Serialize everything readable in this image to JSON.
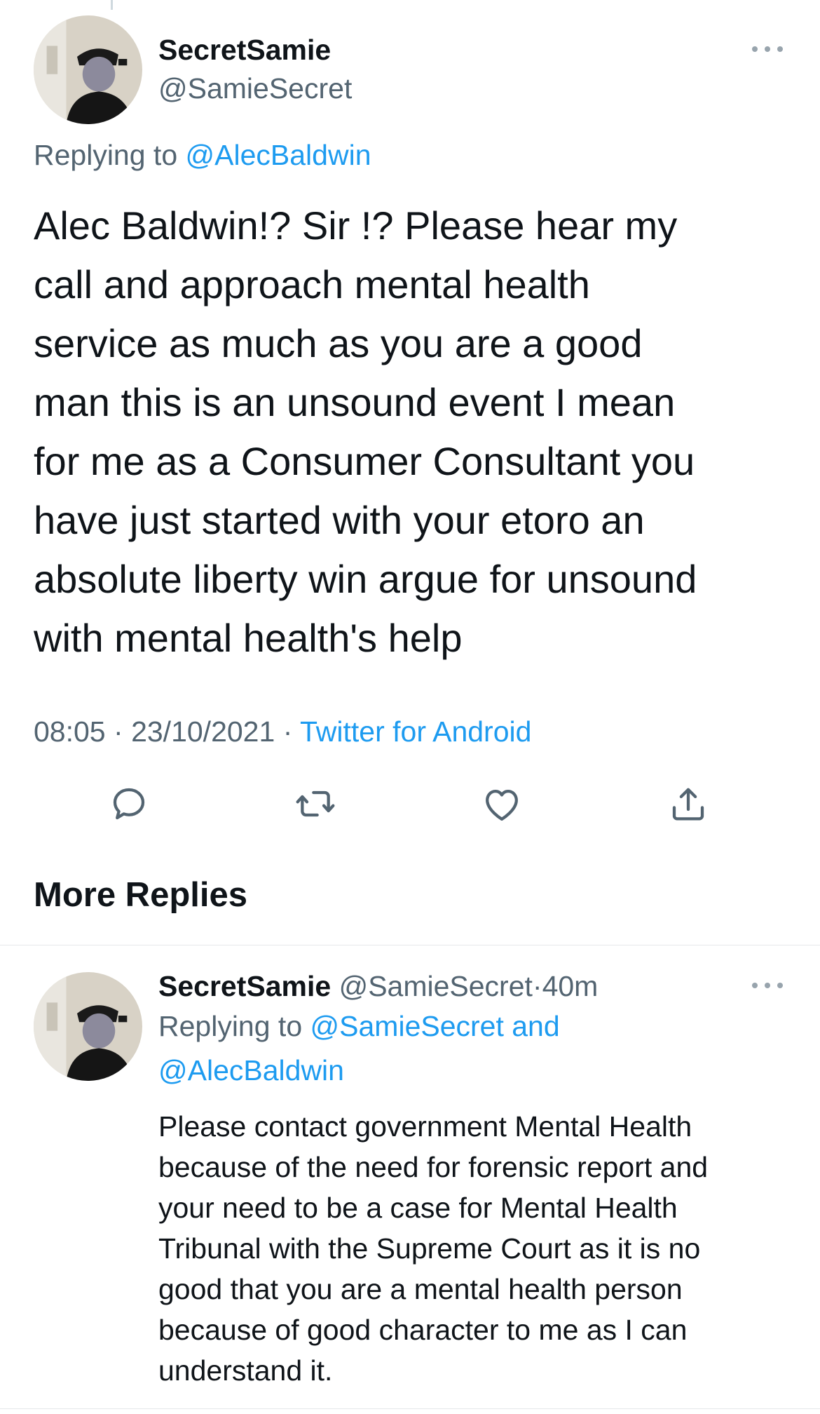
{
  "main_tweet": {
    "display_name": "SecretSamie",
    "handle": "@SamieSecret",
    "replying_to_prefix": "Replying to",
    "replying_to_handle": "@AlecBaldwin",
    "body_lines": [
      "Alec Baldwin!? Sir !? Please hear my",
      "call and approach mental health",
      "service as much as you are a good",
      "man this is an unsound event I mean",
      "for me as a Consumer Consultant you",
      "have just started with your etoro an",
      "absolute liberty win argue for unsound",
      "with mental health's help"
    ],
    "time": "08:05",
    "date": "23/10/2021",
    "separator": "·",
    "source": "Twitter for Android",
    "actions": [
      "reply-icon",
      "retweet-icon",
      "like-icon",
      "share-icon"
    ]
  },
  "section": {
    "title": "More Replies"
  },
  "reply": {
    "display_name": "SecretSamie",
    "handle": "@SamieSecret",
    "time_sep": "·",
    "time_ago": "40m",
    "replying_to_prefix": "Replying to",
    "replying_to_line1": "@SamieSecret and",
    "replying_to_line2": "@AlecBaldwin",
    "body_lines": [
      "Please contact government Mental Health",
      "because of the need for forensic report and",
      "your need to be a case for Mental Health",
      "Tribunal with the Supreme Court as it is no",
      "good that you are a mental health person",
      "because of good character to me as I can",
      "understand it."
    ]
  },
  "colors": {
    "link": "#1d9bf0",
    "muted": "#536471",
    "text": "#0f1419",
    "divider": "#e5e7ea"
  }
}
